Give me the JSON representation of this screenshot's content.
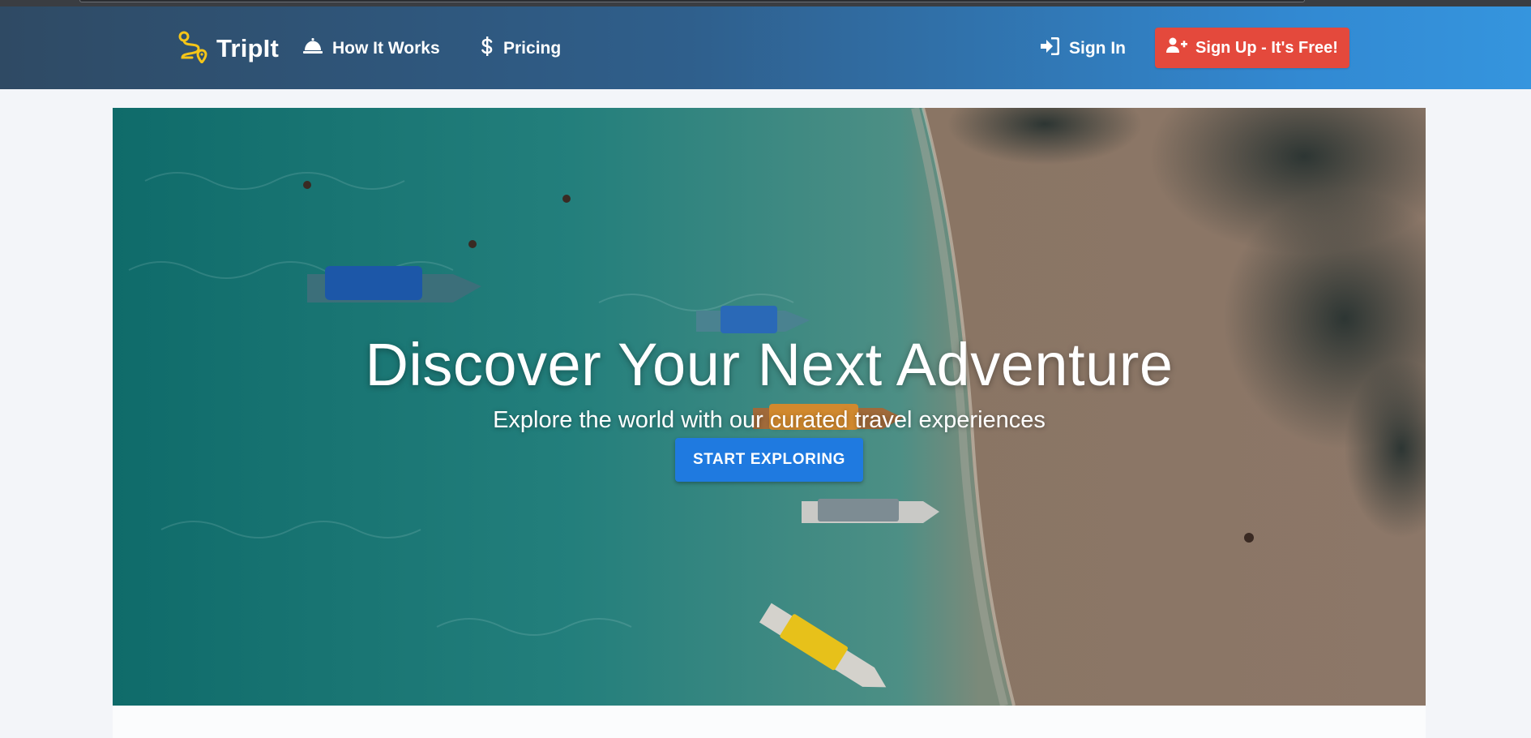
{
  "brand": {
    "name": "TripIt",
    "logo_icon": "route-pin-icon",
    "logo_color": "#f5c518"
  },
  "nav": {
    "how_it_works": {
      "label": "How It Works",
      "icon": "bell-icon"
    },
    "pricing": {
      "label": "Pricing",
      "icon": "dollar-icon"
    },
    "sign_in": {
      "label": "Sign In",
      "icon": "sign-in-icon"
    },
    "sign_up": {
      "label": "Sign Up - It's Free!",
      "icon": "user-plus-icon",
      "color": "#e4493c"
    }
  },
  "hero": {
    "title": "Discover Your Next Adventure",
    "subtitle": "Explore the world with our curated travel experiences",
    "cta_label": "START EXPLORING",
    "cta_color": "#1f7ae0"
  },
  "colors": {
    "nav_gradient_start": "#2f4a64",
    "nav_gradient_end": "#3595de",
    "page_background": "#f3f5f9"
  }
}
